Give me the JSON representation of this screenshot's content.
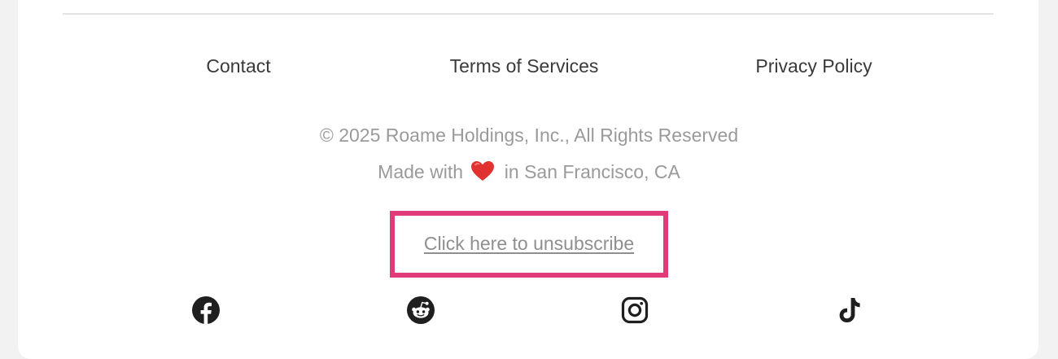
{
  "footer": {
    "links": {
      "contact": "Contact",
      "terms": "Terms of Services",
      "privacy": "Privacy Policy"
    },
    "copyright": "© 2025 Roame Holdings, Inc., All Rights Reserved",
    "made_with_prefix": "Made with",
    "made_with_suffix": "in San Francisco, CA",
    "unsubscribe_label": "Click here to unsubscribe",
    "social_icons": [
      "facebook-icon",
      "reddit-icon",
      "instagram-icon",
      "tiktok-icon"
    ]
  },
  "colors": {
    "page_background": "#f2f2f2",
    "card_background": "#ffffff",
    "link_text": "#3a3a3a",
    "muted_text": "#9a9a9a",
    "highlight_border": "#e03a7a",
    "heart": "#e0322f",
    "icon": "#1f1f1f"
  }
}
